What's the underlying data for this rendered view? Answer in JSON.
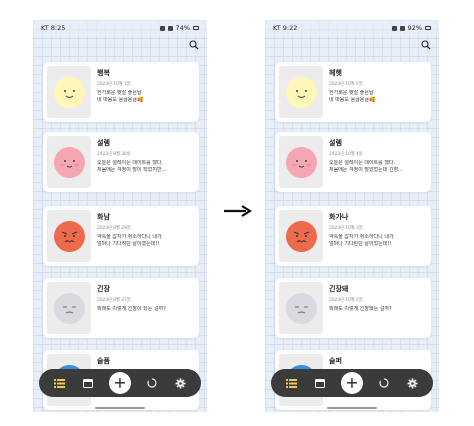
{
  "left": {
    "status": {
      "time": "KT 8:25",
      "battery": "74%"
    },
    "entries": [
      {
        "title": "행복",
        "date": "2023년 10월 1일",
        "body1": "한가로운 햇살 좋은날",
        "body2": "내 마음도 몽글몽글🥰"
      },
      {
        "title": "설렘",
        "date": "2023년 9월 30일",
        "body1": "오늘은 설레이는 데이트를 했다.",
        "body2": "처음에는 걱정이 많이 되었지만..."
      },
      {
        "title": "화남",
        "date": "2023년 9월 29일",
        "body1": "약속을 갑자기 취소하다니 내가",
        "body2": "얼마나 기다려던 날이였는데!!"
      },
      {
        "title": "긴장",
        "date": "2023년 9월 27일",
        "body1": "뭐래도 이렇게 긴장이 되는 걸까?",
        "body2": ""
      },
      {
        "title": "슬픔",
        "date": "",
        "body1": "",
        "body2": ""
      }
    ],
    "add_label": "+"
  },
  "right": {
    "status": {
      "time": "KT 9:22",
      "battery": "92%"
    },
    "entries": [
      {
        "title": "헤헷",
        "date": "2023년 10월 5일",
        "body1": "한가로운 햇살 좋은날",
        "body2": "내 마음도 몽글몽글🥰"
      },
      {
        "title": "설렘",
        "date": "2023년 10월 4일",
        "body1": "오늘은 설레이는 데이트를 했다.",
        "body2": "처음에는 걱정이 많았었는데 긴장..."
      },
      {
        "title": "화가나",
        "date": "2023년 10월 3일",
        "body1": "약속을 갑자기 취소하다니 내가",
        "body2": "얼마나 기다린던 날이었는데!!"
      },
      {
        "title": "긴장돼",
        "date": "2023년 10월 2일",
        "body1": "뭐래도 이렇게 긴장돼는 걸까?",
        "body2": ""
      },
      {
        "title": "슬퍼",
        "date": "",
        "body1": "",
        "body2": ""
      }
    ],
    "add_label": "+"
  },
  "colors": {
    "happy": "#fff6b8",
    "excited": "#f4a7b3",
    "angry": "#ee6a4c",
    "nervous": "#dcd8e0",
    "sad": "#3b8fe0",
    "navbar": "#3b3b3b"
  },
  "icons": [
    "search-icon",
    "list-icon",
    "calendar-icon",
    "add-icon",
    "loading-icon",
    "gear-icon",
    "arrow-right-icon"
  ]
}
